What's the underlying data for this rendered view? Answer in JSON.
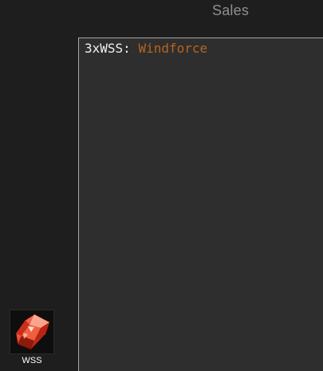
{
  "header": {
    "title": "Sales"
  },
  "sale": {
    "prefix": "3xWSS: ",
    "item_name": "Windforce",
    "item_name_color": "#b7641f"
  },
  "item": {
    "label": "WSS",
    "icon": "worldstone-shard-icon"
  }
}
